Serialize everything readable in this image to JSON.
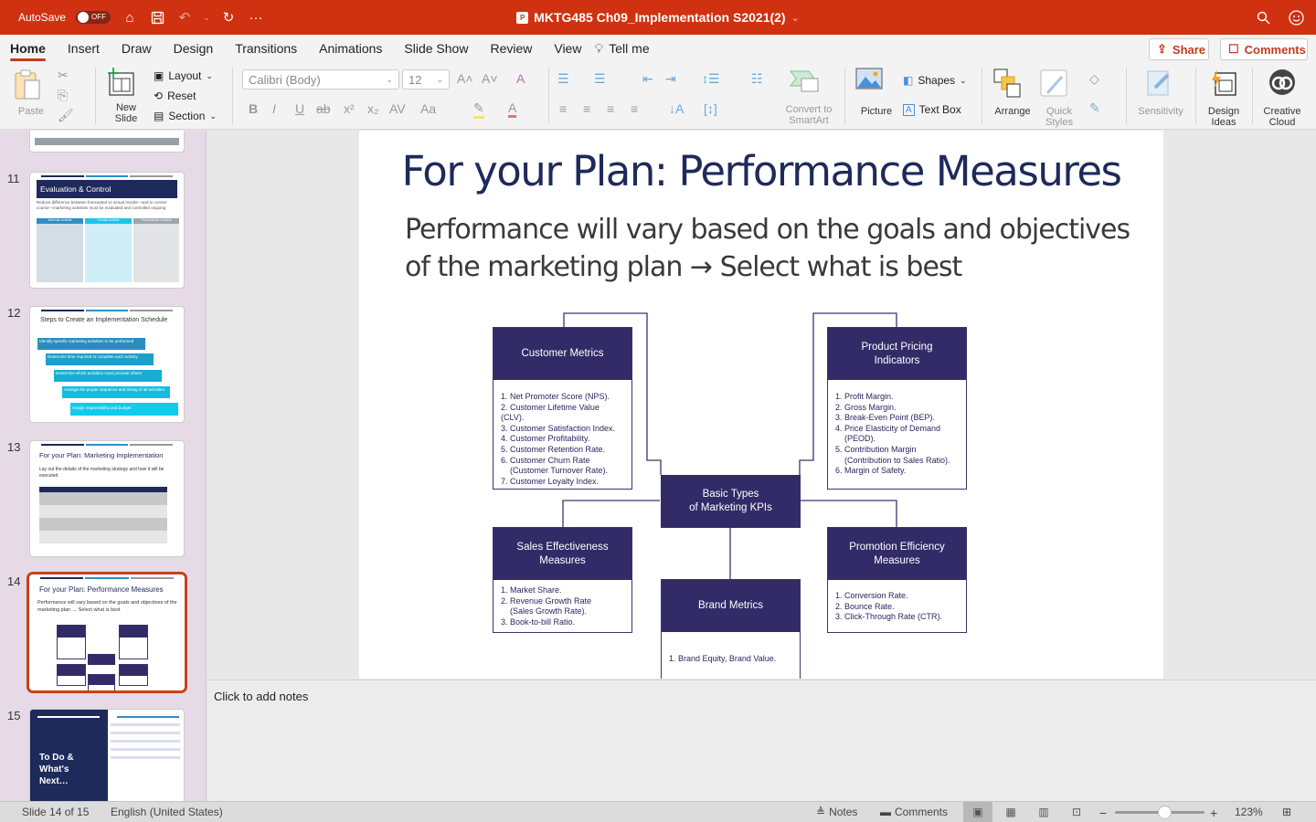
{
  "titlebar": {
    "autosave_label": "AutoSave",
    "autosave_state": "OFF",
    "document_title": "MKTG485 Ch09_Implementation S2021(2)",
    "icons": [
      "home-icon",
      "save-icon",
      "undo-icon",
      "redo-icon",
      "more-icon",
      "search-icon",
      "smiley-feedback-icon"
    ]
  },
  "tabs": [
    {
      "label": "Home",
      "active": true
    },
    {
      "label": "Insert"
    },
    {
      "label": "Draw"
    },
    {
      "label": "Design"
    },
    {
      "label": "Transitions"
    },
    {
      "label": "Animations"
    },
    {
      "label": "Slide Show"
    },
    {
      "label": "Review"
    },
    {
      "label": "View"
    },
    {
      "label": "Tell me"
    }
  ],
  "header_buttons": {
    "share": "Share",
    "comments": "Comments"
  },
  "ribbon": {
    "paste": "Paste",
    "new_slide": "New\nSlide",
    "layout": "Layout",
    "reset": "Reset",
    "section": "Section",
    "font_name": "Calibri (Body)",
    "font_size": "12",
    "convert_smartart": "Convert to\nSmartArt",
    "picture": "Picture",
    "shapes": "Shapes",
    "text_box": "Text Box",
    "arrange": "Arrange",
    "quick_styles": "Quick\nStyles",
    "sensitivity": "Sensitivity",
    "design_ideas": "Design\nIdeas",
    "creative_cloud": "Creative\nCloud",
    "format_glyphs": {
      "bold": "B",
      "italic": "I",
      "underline": "U",
      "strike": "ab",
      "superscript": "x²",
      "subscript": "x₂",
      "spacing": "AV",
      "case": "Aa"
    }
  },
  "thumbnails": [
    {
      "number": "11",
      "title": "Evaluation & Control",
      "text": "Reduce difference between forecasted vs actual results—and to correct course—marketing activities must be evaluated and controlled ongoing",
      "columns": [
        "Informal controls",
        "Formal controls",
        "Performance controls"
      ]
    },
    {
      "number": "12",
      "title": "Steps to Create an Implementation Schedule",
      "steps": [
        "Identify specific marketing activities to be performed",
        "Determine time required to complete each activity",
        "Determine which activities must precede others",
        "Arrange the proper sequence and timing of all activities",
        "Assign responsibility and budget"
      ]
    },
    {
      "number": "13",
      "title": "For your Plan: Marketing Implementation",
      "text": "Lay out the details of the marketing strategy and how it will be executed"
    },
    {
      "number": "14",
      "title": "For your Plan: Performance Measures",
      "text": "Performance will vary based on the goals and objectives of the marketing plan → Select what is best",
      "selected": true
    },
    {
      "number": "15",
      "title": "To Do & What's Next…"
    }
  ],
  "slide": {
    "title": "For your Plan: Performance Measures",
    "body_line1": "Performance will vary based on the goals and objectives",
    "body_line2": "of the marketing plan → Select what is best",
    "center": "Basic Types\nof Marketing KPIs",
    "boxes": {
      "customer": {
        "title": "Customer Metrics",
        "items": [
          "1. Net Promoter Score (NPS).",
          "2. Customer Lifetime Value (CLV).",
          "3. Customer Satisfaction Index.",
          "4. Customer Profitability.",
          "5. Customer Retention Rate.",
          "6. Customer Churn Rate",
          "    (Customer Turnover Rate).",
          "7. Customer Loyalty Index."
        ]
      },
      "pricing": {
        "title": "Product Pricing\nIndicators",
        "items": [
          "1. Profit Margin.",
          "2. Gross Margin.",
          "3. Break-Even Point (BEP).",
          "4. Price Elasticity of Demand",
          "    (PEOD).",
          "5. Contribution Margin",
          "    (Contribution to Sales Ratio).",
          "6. Margin of Safety."
        ]
      },
      "sales": {
        "title": "Sales Effectiveness\nMeasures",
        "items": [
          "1. Market Share.",
          "2. Revenue Growth Rate",
          "    (Sales Growth Rate).",
          "3. Book-to-bill Ratio."
        ]
      },
      "brand": {
        "title": "Brand Metrics",
        "items": [
          "1. Brand Equity, Brand Value."
        ]
      },
      "promotion": {
        "title": "Promotion Efficiency\nMeasures",
        "items": [
          "1. Conversion Rate.",
          "2. Bounce Rate.",
          "3. Click-Through Rate (CTR)."
        ]
      }
    }
  },
  "notes": {
    "placeholder": "Click to add notes"
  },
  "status": {
    "slide_info": "Slide 14 of 15",
    "language": "English (United States)",
    "notes": "Notes",
    "comments": "Comments",
    "zoom": "123%",
    "zoom_fraction": 0.55
  }
}
